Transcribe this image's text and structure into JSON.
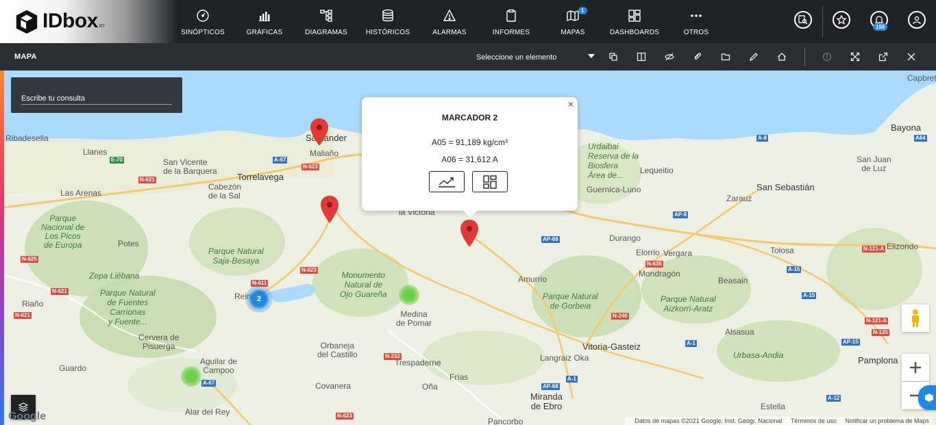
{
  "app": {
    "logo_text": "IDbox",
    "logo_sub": "RT"
  },
  "nav": [
    {
      "label": "SINÓPTICOS",
      "icon": "gauge-icon"
    },
    {
      "label": "GRÁFICAS",
      "icon": "bar-chart-icon"
    },
    {
      "label": "DIAGRAMAS",
      "icon": "diagram-tree-icon"
    },
    {
      "label": "HISTÓRICOS",
      "icon": "database-icon"
    },
    {
      "label": "ALARMAS",
      "icon": "warning-triangle-icon"
    },
    {
      "label": "INFORMES",
      "icon": "clipboard-icon"
    },
    {
      "label": "MAPAS",
      "icon": "map-icon",
      "badge": "1"
    },
    {
      "label": "DASHBOARDS",
      "icon": "dashboard-grid-icon"
    },
    {
      "label": "OTROS",
      "icon": "ellipsis-icon"
    }
  ],
  "notifications_count": "150",
  "subbar": {
    "title": "MAPA",
    "selector_label": "Seleccione un elemento"
  },
  "search": {
    "placeholder": "Escribe tu consulta"
  },
  "popup": {
    "title": "MARCADOR 2",
    "line1": "A05 = 91,189 kg/cm³",
    "line2": "A06 = 31,612 A"
  },
  "cluster_count": "2",
  "map_labels": {
    "santander": "Santander",
    "maliano": "Maliaño",
    "torrelavega": "Torrelavega",
    "san_vicente": "San Vicente\nde la Barquera",
    "llanes": "Llanes",
    "ribadesella": "Ribadesella",
    "las_arenas": "Las Arenas",
    "cabezon": "Cabezón\nde la Sal",
    "picos": "Parque\nNacional de\nLos Picos\nde Europa",
    "potes": "Potes",
    "saja": "Parque Natural\nSaja-Besaya",
    "zepa": "Zepa Liébana",
    "fuentes": "Parque Natural\nde Fuentes\nCarrionas\ny Fuente...",
    "riano": "Riaño",
    "cervera": "Cervera de\nPisuerga",
    "guardo": "Guardo",
    "aguilar": "Aguilar de\nCampoo",
    "alar": "Alar del Rey",
    "reinosa": "Reinosa",
    "ojo": "Monumento\nNatural de\nOjo Guareña",
    "medina": "Medina\nde Pomar",
    "orbaneja": "Orbaneja\ndel Castillo",
    "covanera": "Covanera",
    "trespaderne": "Trespaderne",
    "frias": "Frías",
    "ona": "Oña",
    "pancorbo": "Pancorbo",
    "miranda": "Miranda\nde Ebro",
    "victoria": "la Victoria",
    "amurrio": "Amurrio",
    "gorbeia": "Parque Natural\nde Gorbeia",
    "vitoria": "Vitoria-Gasteiz",
    "langraiz": "Langraiz Oka",
    "urdaibai": "Urdaibai\nReserva de la\nBiosfera\nÁrea de...",
    "lequeitio": "Lequeitio",
    "guernica": "Guernica-Luno",
    "durango": "Durango",
    "elorrio": "Elorrio",
    "vergara": "Vergara",
    "mondragon": "Mondragón",
    "aizkorri": "Parque Natural\nAizkorri-Aratz",
    "beasain": "Beasain",
    "zarauz": "Zarauz",
    "sansebastian": "San Sebastián",
    "tolosa": "Tolosa",
    "alsasua": "Alsasua",
    "urbasa": "Urbasa-Andia",
    "pamplona": "Pamplona",
    "estella": "Estella",
    "elizondo": "Elizondo",
    "bayona": "Bayona",
    "sanjuan": "San Juan\nde Luz",
    "capbreton": "Capbret"
  },
  "roads": [
    "A-67",
    "N-623",
    "E-70",
    "N-621",
    "N-625",
    "N-611",
    "N-623",
    "N-621",
    "N-621",
    "A-67",
    "N-232",
    "N-623",
    "AP-68",
    "AP-68",
    "A-1",
    "N-240",
    "A-1",
    "N-636",
    "AP-8",
    "A-15",
    "A-15",
    "N-121-A",
    "N-121-A",
    "AP-15",
    "N-135",
    "A-12",
    "A64",
    "A-8"
  ],
  "attribution": {
    "data": "Datos de mapas ©2021 Google, Inst. Geogr. Nacional",
    "terms": "Términos de uso",
    "report": "Notificar un problema de Maps"
  },
  "google_logo": "Google",
  "colors": {
    "topbar": "#202226",
    "subbar": "#2a2d33",
    "marker": "#e53935",
    "cluster": "#1e88e5",
    "heat": "#6bd14a",
    "sea": "#aadaff"
  }
}
